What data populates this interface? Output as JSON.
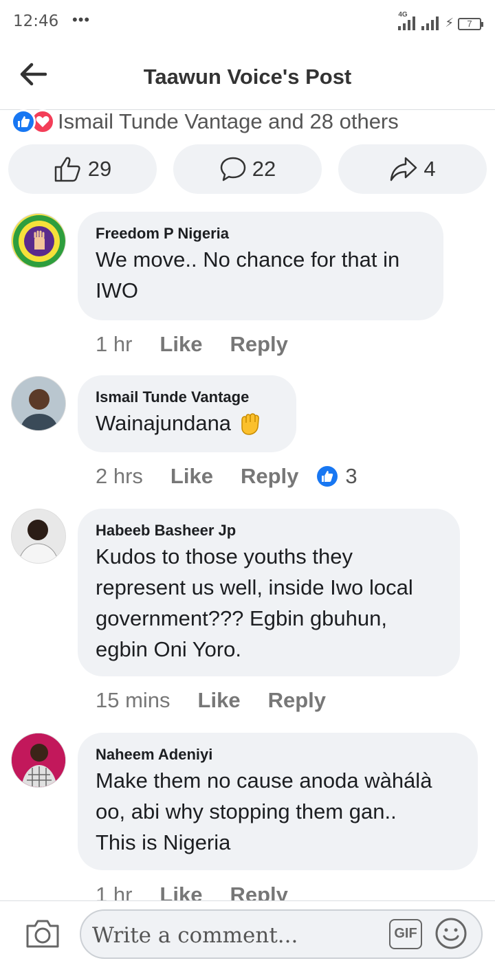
{
  "status_bar": {
    "time": "12:46",
    "dots": "•••",
    "network": "4G",
    "battery": "7"
  },
  "header": {
    "title": "Taawun Voice's Post"
  },
  "reactions": {
    "summary": "Ismail Tunde Vantage and 28 others"
  },
  "actions": {
    "likes": "29",
    "comments": "22",
    "shares": "4"
  },
  "comments": [
    {
      "name": "Freedom P Nigeria",
      "lines": [
        "We move.. No chance for that in",
        "IWO"
      ],
      "time": "1 hr",
      "like": "Like",
      "reply": "Reply"
    },
    {
      "name": "Ismail Tunde Vantage",
      "lines": [
        "Wainajundana"
      ],
      "time": "2 hrs",
      "like": "Like",
      "reply": "Reply",
      "reaction_count": "3"
    },
    {
      "name": "Habeeb Basheer Jp",
      "lines": [
        "Kudos to those youths they",
        "represent us well, inside Iwo local",
        "government??? Egbin gbuhun,",
        "egbin Oni Yoro."
      ],
      "time": "15 mins",
      "like": "Like",
      "reply": "Reply"
    },
    {
      "name": "Naheem Adeniyi",
      "lines": [
        "Make them no cause anoda wàhálà",
        "oo, abi why stopping them gan..",
        "This is Nigeria"
      ],
      "time": "1 hr",
      "like": "Like",
      "reply": "Reply"
    }
  ],
  "composer": {
    "placeholder": "Write a comment...",
    "gif_label": "GIF"
  },
  "colors": {
    "accent": "#1877f2",
    "love": "#f33e58",
    "bubble": "#f0f2f5"
  }
}
